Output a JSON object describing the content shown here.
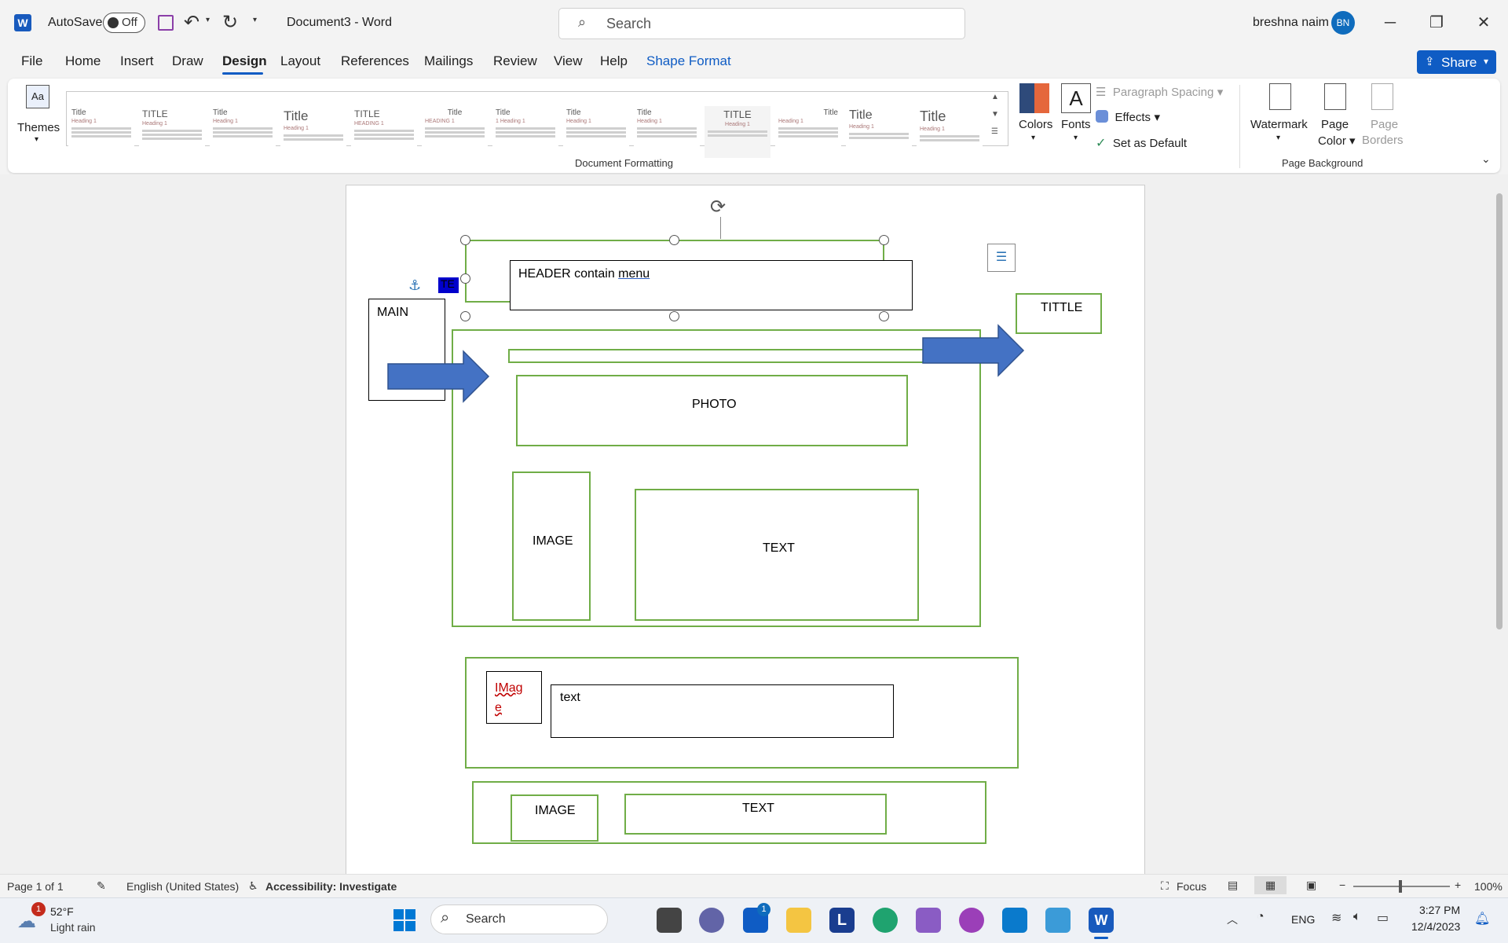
{
  "titlebar": {
    "autosave_label": "AutoSave",
    "autosave_state": "Off",
    "doc_title": "Document3  -  Word",
    "search_placeholder": "Search",
    "user_name": "breshna naim",
    "user_initials": "BN"
  },
  "tabs": [
    "File",
    "Home",
    "Insert",
    "Draw",
    "Design",
    "Layout",
    "References",
    "Mailings",
    "Review",
    "View",
    "Help",
    "Shape Format"
  ],
  "active_tab": "Design",
  "share_label": "Share",
  "ribbon": {
    "themes_label": "Themes",
    "gallery_titles": [
      "Title",
      "TITLE",
      "Title",
      "Title",
      "TITLE",
      "Title",
      "Title",
      "Title",
      "Title",
      "TITLE",
      "Title",
      "Title",
      "Title"
    ],
    "colors_label": "Colors",
    "fonts_label": "Fonts",
    "paragraph_spacing_label": "Paragraph Spacing",
    "effects_label": "Effects",
    "set_default_label": "Set as Default",
    "document_formatting_label": "Document Formatting",
    "watermark_label": "Watermark",
    "page_color_label": "Page Color",
    "page_borders_label": "Page Borders",
    "page_background_label": "Page Background"
  },
  "document": {
    "header_text_1": "HEADER contain ",
    "header_text_2": "menu",
    "main_label": "MAIN",
    "tittle_label": "TITTLE",
    "photo_label": "PHOTO",
    "image_label": "IMAGE",
    "text_label": "TEXT",
    "image_mixed_1": "IMag",
    "image_mixed_2": "e",
    "text_lower": "text",
    "image_label_2": "IMAGE",
    "text_label_2": "TEXT",
    "selected_chars": "TE"
  },
  "statusbar": {
    "page": "Page 1 of 1",
    "language": "English (United States)",
    "accessibility": "Accessibility: Investigate",
    "focus": "Focus",
    "zoom": "100%"
  },
  "taskbar": {
    "weather_temp": "52°F",
    "weather_desc": "Light rain",
    "weather_badge": "1",
    "search_label": "Search",
    "lang": "ENG",
    "time": "3:27 PM",
    "date": "12/4/2023",
    "store_badge": "1"
  },
  "colors": {
    "accent": "#0f5cc4",
    "shape_outline": "#70ad47",
    "arrow_fill": "#4472c4"
  }
}
